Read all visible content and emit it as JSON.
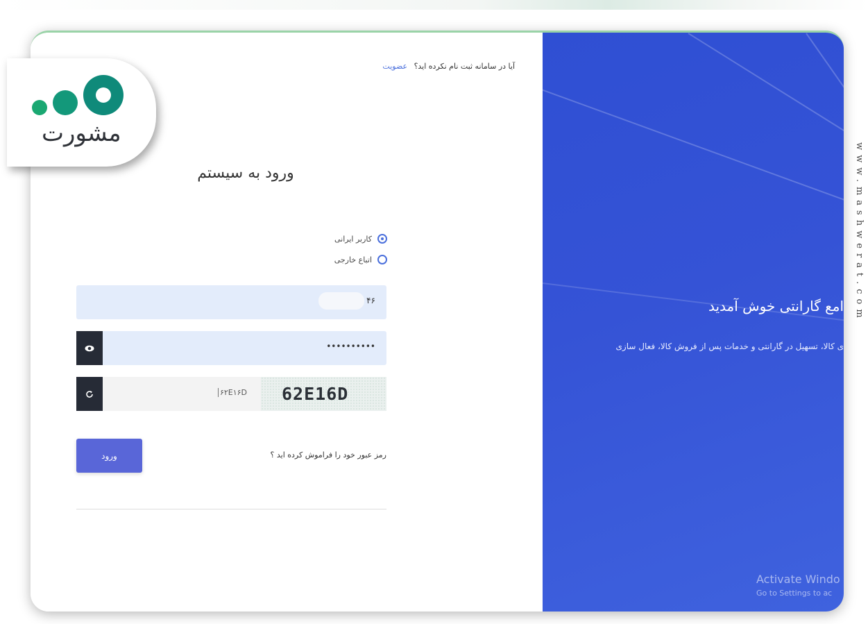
{
  "header": {
    "register_question": "آیا در سامانه ثبت نام نکرده اید؟",
    "register_link": "عضویت"
  },
  "login": {
    "title": "ورود به سیستم",
    "user_types": [
      {
        "label": "کاربر ایرانی",
        "selected": true
      },
      {
        "label": "اتباع خارجی",
        "selected": false
      }
    ],
    "username_visible_value": "۴۶",
    "password_masked": "••••••••••",
    "captcha_input_value": "۶۲E۱۶D",
    "captcha_image_text": "62E16D",
    "submit_label": "ورود",
    "forgot_password": "رمز عبور خود را فراموش کرده اید ؟"
  },
  "welcome": {
    "title": "امع گارانتی خوش آمدید",
    "subtitle": "ی کالا، تسهیل در گارانتی و خدمات پس از فروش کالا، فعال سازی"
  },
  "os_overlay": {
    "activate_title": "Activate Windo",
    "activate_sub": "Go to Settings to ac"
  },
  "branding": {
    "logo_text": "مشورت",
    "watermark": "www.mashwerat.com"
  },
  "colors": {
    "primary_blue": "#3553d6",
    "button": "#5966d8",
    "input_bg": "#e3ecfb",
    "icon_button": "#262b36",
    "logo_green": "#1aa872",
    "logo_teal": "#0f8a7a"
  },
  "icons": {
    "show_password": "eye-icon",
    "refresh_captcha": "refresh-icon"
  }
}
